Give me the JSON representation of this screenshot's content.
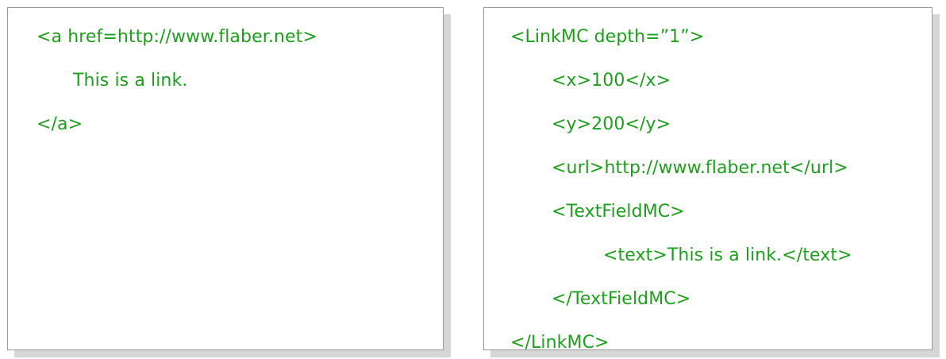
{
  "left_panel": {
    "lines": [
      "<a href=http://www.flaber.net>",
      "This is a link.",
      "</a>"
    ]
  },
  "right_panel": {
    "lines": [
      "<LinkMC depth=”1”>",
      "<x>100</x>",
      "<y>200</y>",
      "<url>http://www.flaber.net</url>",
      "<TextFieldMC>",
      "<text>This is a link.</text>",
      "</TextFieldMC>",
      "</LinkMC>"
    ]
  },
  "colors": {
    "code_text": "#1f9d1f",
    "panel_border": "#9a9a9a",
    "panel_shadow": "#d6d6d6"
  }
}
